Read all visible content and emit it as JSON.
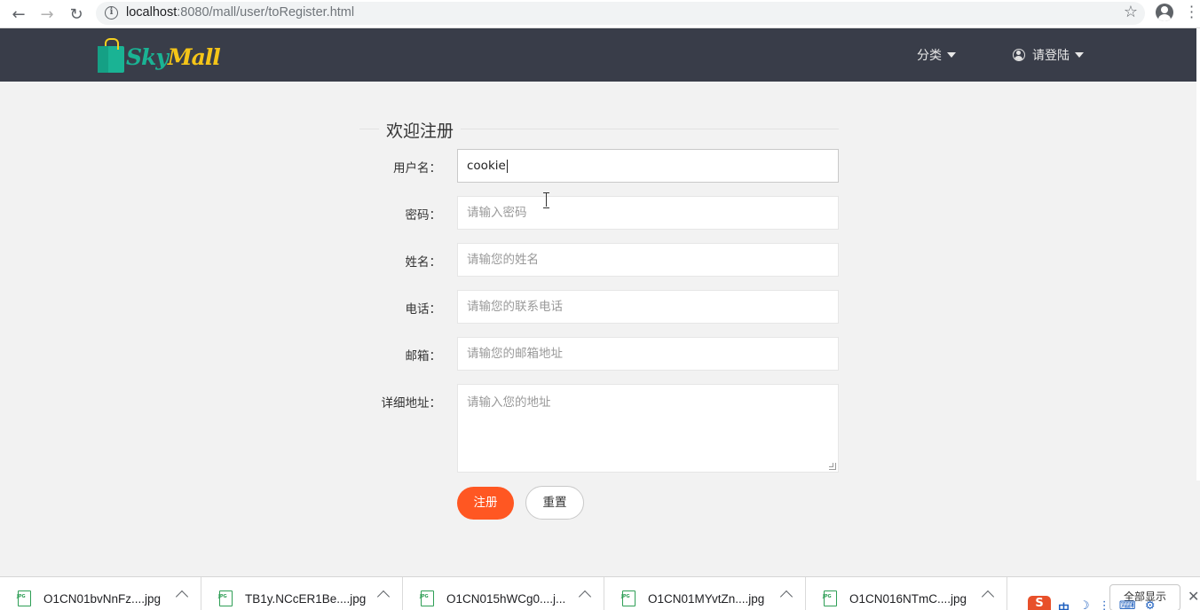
{
  "browser": {
    "url_host": "localhost",
    "url_rest": ":8080/mall/user/toRegister.html"
  },
  "header": {
    "logo_sky": "Sky",
    "logo_mall": "Mall",
    "nav_category": "分类",
    "nav_login": "请登陆"
  },
  "form": {
    "title": "欢迎注册",
    "fields": [
      {
        "label": "用户名：",
        "value": "cookie",
        "placeholder": ""
      },
      {
        "label": "密码：",
        "value": "",
        "placeholder": "请输入密码"
      },
      {
        "label": "姓名：",
        "value": "",
        "placeholder": "请输您的姓名"
      },
      {
        "label": "电话：",
        "value": "",
        "placeholder": "请输您的联系电话"
      },
      {
        "label": "邮箱：",
        "value": "",
        "placeholder": "请输您的邮箱地址"
      }
    ],
    "address": {
      "label": "详细地址：",
      "placeholder": "请输入您的地址"
    },
    "register_label": "注册",
    "reset_label": "重置"
  },
  "downloads": {
    "items": [
      {
        "name": "O1CN01bvNnFz....jpg"
      },
      {
        "name": "TB1y.NCcER1Be....jpg"
      },
      {
        "name": "O1CN015hWCg0....j..."
      },
      {
        "name": "O1CN01MYvtZn....jpg"
      },
      {
        "name": "O1CN016NTmC....jpg"
      }
    ],
    "show_all": "全部显示"
  },
  "ime": {
    "logo": "S",
    "mode": "中"
  },
  "colors": {
    "header_bg": "#393d49",
    "register_button": "#ff5722",
    "logo_green": "#1ab394",
    "logo_yellow": "#f5c518"
  }
}
